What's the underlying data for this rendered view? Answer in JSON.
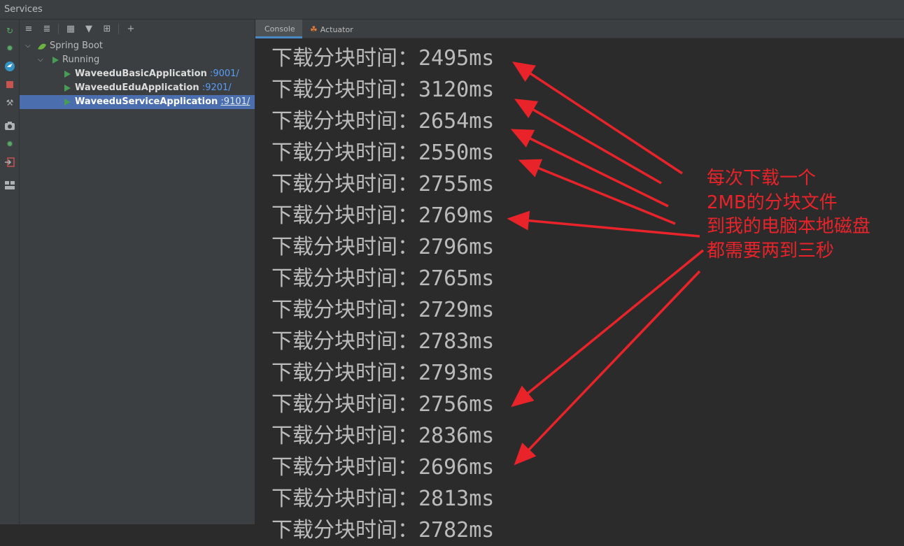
{
  "window": {
    "title": "Services"
  },
  "toolstrip": {
    "icons": [
      "rerun-icon",
      "debug-icon",
      "update-icon",
      "stop-icon",
      "settings-wrench-icon",
      "screenshot-icon",
      "debug-bug-icon",
      "exit-icon",
      "layout-icon"
    ]
  },
  "tree_toolbar": {
    "icons": [
      "expand-all-icon",
      "collapse-all-icon",
      "group-by-icon",
      "filter-icon",
      "new-service-icon",
      "add-icon"
    ]
  },
  "tree": {
    "root": {
      "label": "Spring Boot"
    },
    "group": {
      "label": "Running"
    },
    "apps": [
      {
        "name": "WaveeduBasicApplication",
        "port": ":9001/"
      },
      {
        "name": "WaveeduEduApplication",
        "port": ":9201/"
      },
      {
        "name": "WaveeduServiceApplication",
        "port": ":9101/"
      }
    ]
  },
  "tabs": [
    {
      "label": "Console",
      "active": true
    },
    {
      "label": "Actuator",
      "active": false
    }
  ],
  "console": {
    "lines": [
      "下载分块时间：2495ms",
      "下载分块时间：3120ms",
      "下载分块时间：2654ms",
      "下载分块时间：2550ms",
      "下载分块时间：2755ms",
      "下载分块时间：2769ms",
      "下载分块时间：2796ms",
      "下载分块时间：2765ms",
      "下载分块时间：2729ms",
      "下载分块时间：2783ms",
      "下载分块时间：2793ms",
      "下载分块时间：2756ms",
      "下载分块时间：2836ms",
      "下载分块时间：2696ms",
      "下载分块时间：2813ms",
      "下载分块时间：2782ms"
    ]
  },
  "annotation": {
    "lines": [
      "每次下载一个",
      "2MB的分块文件",
      "到我的电脑本地磁盘",
      "都需要两到三秒"
    ],
    "color": "#e8232a"
  }
}
